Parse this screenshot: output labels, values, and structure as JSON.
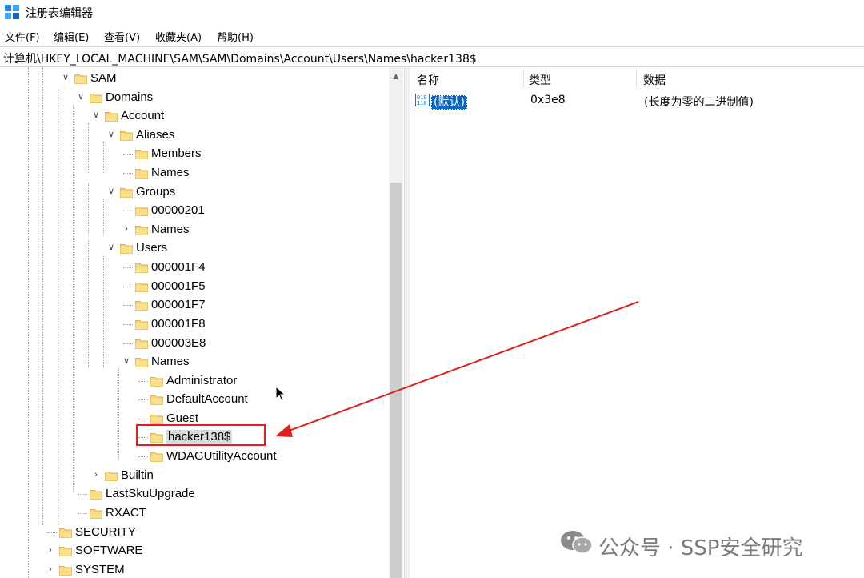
{
  "window": {
    "title": "注册表编辑器",
    "icon": "regedit-icon"
  },
  "menu": [
    "文件(F)",
    "编辑(E)",
    "查看(V)",
    "收藏夹(A)",
    "帮助(H)"
  ],
  "address": "计算机\\HKEY_LOCAL_MACHINE\\SAM\\SAM\\Domains\\Account\\Users\\Names\\hacker138$",
  "tree": [
    {
      "label": "SAM",
      "toggle": "expanded"
    },
    {
      "label": "Domains",
      "toggle": "expanded"
    },
    {
      "label": "Account",
      "toggle": "expanded"
    },
    {
      "label": "Aliases",
      "toggle": "expanded"
    },
    {
      "label": "Members",
      "toggle": "none"
    },
    {
      "label": "Names",
      "toggle": "none"
    },
    {
      "label": "Groups",
      "toggle": "expanded"
    },
    {
      "label": "00000201",
      "toggle": "none"
    },
    {
      "label": "Names",
      "toggle": "collapsed"
    },
    {
      "label": "Users",
      "toggle": "expanded"
    },
    {
      "label": "000001F4",
      "toggle": "none"
    },
    {
      "label": "000001F5",
      "toggle": "none"
    },
    {
      "label": "000001F7",
      "toggle": "none"
    },
    {
      "label": "000001F8",
      "toggle": "none"
    },
    {
      "label": "000003E8",
      "toggle": "none"
    },
    {
      "label": "Names",
      "toggle": "expanded"
    },
    {
      "label": "Administrator",
      "toggle": "none"
    },
    {
      "label": "DefaultAccount",
      "toggle": "none"
    },
    {
      "label": "Guest",
      "toggle": "none"
    },
    {
      "label": "hacker138$",
      "toggle": "none",
      "selected": true
    },
    {
      "label": "WDAGUtilityAccount",
      "toggle": "none"
    },
    {
      "label": "Builtin",
      "toggle": "collapsed"
    },
    {
      "label": "LastSkuUpgrade",
      "toggle": "none"
    },
    {
      "label": "RXACT",
      "toggle": "none"
    },
    {
      "label": "SECURITY",
      "toggle": "none"
    },
    {
      "label": "SOFTWARE",
      "toggle": "collapsed"
    },
    {
      "label": "SYSTEM",
      "toggle": "collapsed"
    }
  ],
  "columns": {
    "name": "名称",
    "type": "类型",
    "data": "数据"
  },
  "values": [
    {
      "name": "(默认)",
      "type": "0x3e8",
      "data": "(长度为零的二进制值)",
      "icon": "binary-value-icon"
    }
  ],
  "watermark": "公众号 · SSP安全研究",
  "colors": {
    "annotation": "#e02020",
    "folder": "#f8d775",
    "selection": "#0a64c8"
  }
}
